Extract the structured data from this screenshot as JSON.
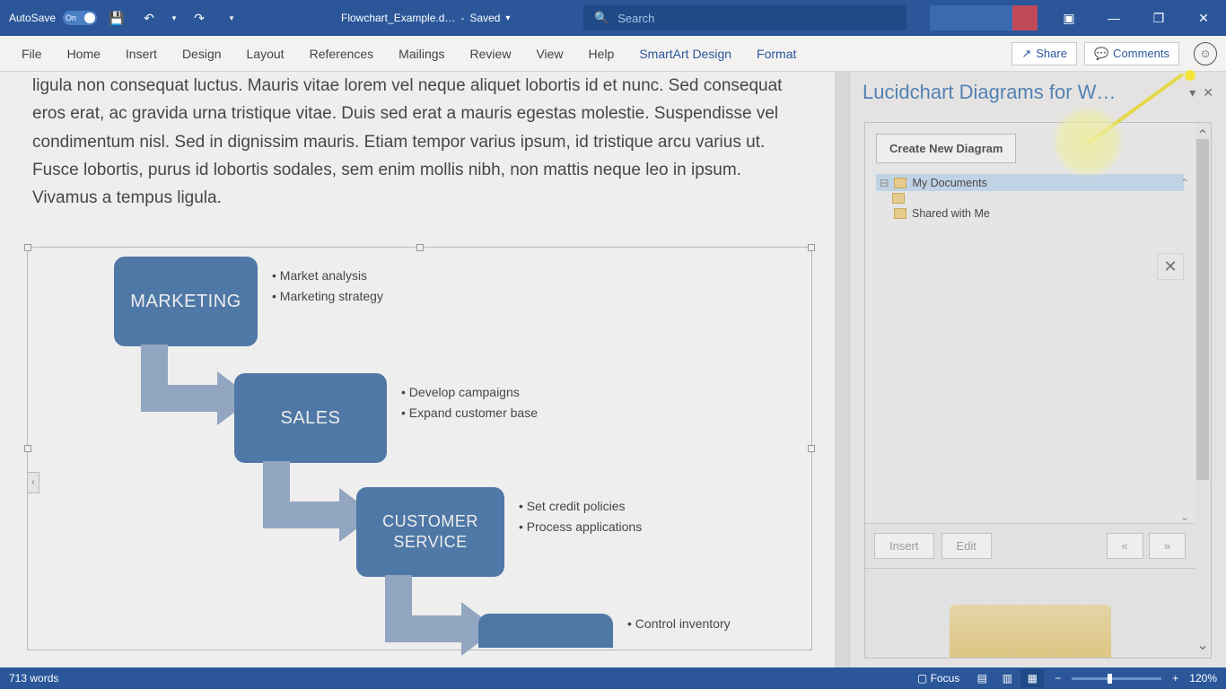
{
  "title_bar": {
    "autosave_label": "AutoSave",
    "autosave_state": "On",
    "doc_name": "Flowchart_Example.d…",
    "save_state": "Saved",
    "search_placeholder": "Search"
  },
  "ribbon": {
    "tabs": [
      "File",
      "Home",
      "Insert",
      "Design",
      "Layout",
      "References",
      "Mailings",
      "Review",
      "View",
      "Help"
    ],
    "context_tabs": [
      "SmartArt Design",
      "Format"
    ],
    "share": "Share",
    "comments": "Comments"
  },
  "document": {
    "paragraph": "ligula non consequat luctus. Mauris vitae lorem vel neque aliquet lobortis id et nunc. Sed consequat eros erat, ac gravida urna tristique vitae. Duis sed erat a mauris egestas molestie. Suspendisse vel condimentum nisl. Sed in dignissim mauris. Etiam tempor varius ipsum, id tristique arcu varius ut. Fusce lobortis, purus id lobortis sodales, sem enim mollis nibh, non mattis neque leo in ipsum. Vivamus a tempus ligula."
  },
  "smartart": {
    "steps": [
      {
        "title": "MARKETING",
        "bullets": [
          "Market analysis",
          "Marketing strategy"
        ]
      },
      {
        "title": "SALES",
        "bullets": [
          "Develop campaigns",
          "Expand customer base"
        ]
      },
      {
        "title": "CUSTOMER SERVICE",
        "bullets": [
          "Set credit policies",
          "Process applications"
        ]
      },
      {
        "title": "",
        "bullets": [
          "Control inventory"
        ]
      }
    ]
  },
  "side_pane": {
    "title": "Lucidchart Diagrams for W…",
    "create_btn": "Create New Diagram",
    "tree": {
      "my_docs": "My Documents",
      "shared": "Shared with Me"
    },
    "footer": {
      "insert": "Insert",
      "edit": "Edit",
      "prev": "«",
      "next": "»"
    }
  },
  "status": {
    "words": "713 words",
    "focus": "Focus",
    "zoom": "120%"
  }
}
